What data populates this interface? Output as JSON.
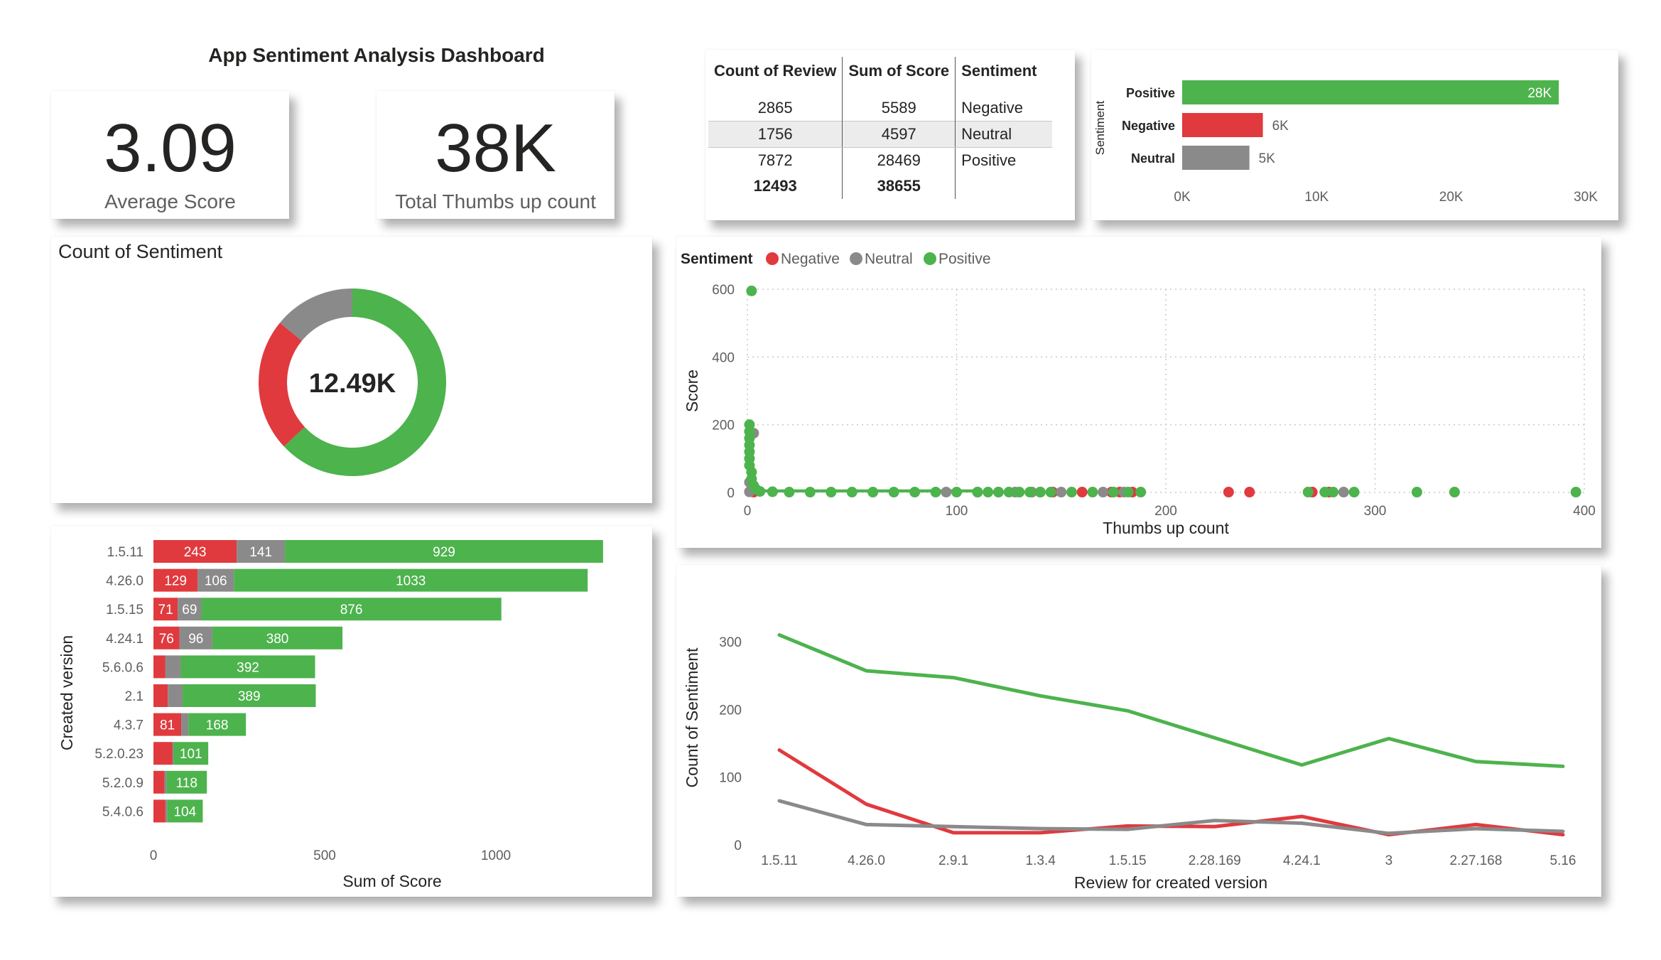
{
  "dashboard": {
    "title": "App Sentiment Analysis Dashboard",
    "colors": {
      "negative": "#e03a3e",
      "neutral": "#8a8a8a",
      "positive": "#4db34d"
    }
  },
  "kpis": [
    {
      "value": "3.09",
      "label": "Average Score"
    },
    {
      "value": "38K",
      "label": "Total Thumbs up count"
    }
  ],
  "review_table": {
    "headers": [
      "Count of Review",
      "Sum of Score",
      "Sentiment"
    ],
    "rows": [
      [
        "2865",
        "5589",
        "Negative"
      ],
      [
        "1756",
        "4597",
        "Neutral"
      ],
      [
        "7872",
        "28469",
        "Positive"
      ]
    ],
    "total": [
      "12493",
      "38655",
      ""
    ]
  },
  "chart_data": [
    {
      "type": "bar",
      "orientation": "horizontal",
      "ylabel": "Sentiment",
      "categories": [
        "Positive",
        "Negative",
        "Neutral"
      ],
      "values": [
        28000,
        6000,
        5000
      ],
      "data_labels": [
        "28K",
        "6K",
        "5K"
      ],
      "xlim": [
        0,
        30000
      ],
      "xticks": [
        "0K",
        "10K",
        "20K",
        "30K"
      ],
      "colors": [
        "#4db34d",
        "#e03a3e",
        "#8a8a8a"
      ]
    },
    {
      "type": "pie",
      "style": "donut",
      "title": "Count of Sentiment",
      "center_label": "12.49K",
      "labels": [
        "Positive",
        "Negative",
        "Neutral"
      ],
      "values": [
        7872,
        2865,
        1756
      ],
      "colors": [
        "#4db34d",
        "#e03a3e",
        "#8a8a8a"
      ]
    },
    {
      "type": "scatter",
      "legend_title": "Sentiment",
      "legend_position": "top-left",
      "xlabel": "Thumbs up count",
      "ylabel": "Score",
      "xlim": [
        0,
        400
      ],
      "ylim": [
        0,
        600
      ],
      "xticks": [
        0,
        100,
        200,
        300,
        400
      ],
      "yticks": [
        0,
        200,
        400,
        600
      ],
      "grid": true,
      "series": [
        {
          "name": "Negative",
          "color": "#e03a3e",
          "points": [
            [
              1,
              2
            ],
            [
              3,
              1
            ],
            [
              140,
              1
            ],
            [
              146,
              1
            ],
            [
              160,
              1
            ],
            [
              174,
              1
            ],
            [
              178,
              1
            ],
            [
              184,
              1
            ],
            [
              230,
              1
            ],
            [
              240,
              1
            ],
            [
              270,
              1
            ],
            [
              278,
              1
            ]
          ]
        },
        {
          "name": "Neutral",
          "color": "#8a8a8a",
          "points": [
            [
              1,
              30
            ],
            [
              3,
              175
            ],
            [
              1,
              2
            ],
            [
              95,
              1
            ],
            [
              110,
              1
            ],
            [
              120,
              1
            ],
            [
              128,
              1
            ],
            [
              136,
              1
            ],
            [
              150,
              1
            ],
            [
              170,
              1
            ],
            [
              180,
              1
            ],
            [
              285,
              1
            ]
          ]
        },
        {
          "name": "Positive",
          "color": "#4db34d",
          "points": [
            [
              2,
              595
            ],
            [
              1,
              200
            ],
            [
              1,
              180
            ],
            [
              1,
              160
            ],
            [
              1,
              140
            ],
            [
              1,
              120
            ],
            [
              1,
              100
            ],
            [
              1,
              80
            ],
            [
              2,
              60
            ],
            [
              2,
              40
            ],
            [
              3,
              20
            ],
            [
              4,
              10
            ],
            [
              6,
              3
            ],
            [
              12,
              2
            ],
            [
              20,
              1
            ],
            [
              30,
              1
            ],
            [
              40,
              1
            ],
            [
              50,
              1
            ],
            [
              60,
              1
            ],
            [
              70,
              1
            ],
            [
              80,
              1
            ],
            [
              90,
              1
            ],
            [
              100,
              1
            ],
            [
              110,
              1
            ],
            [
              115,
              1
            ],
            [
              120,
              1
            ],
            [
              125,
              1
            ],
            [
              130,
              1
            ],
            [
              135,
              1
            ],
            [
              140,
              1
            ],
            [
              145,
              1
            ],
            [
              155,
              1
            ],
            [
              165,
              1
            ],
            [
              175,
              1
            ],
            [
              182,
              1
            ],
            [
              188,
              1
            ],
            [
              268,
              1
            ],
            [
              276,
              1
            ],
            [
              280,
              1
            ],
            [
              290,
              1
            ],
            [
              320,
              1
            ],
            [
              338,
              1
            ],
            [
              396,
              1
            ]
          ]
        }
      ]
    },
    {
      "type": "bar",
      "orientation": "horizontal",
      "stacked": true,
      "xlabel": "Sum of Score",
      "ylabel": "Created version",
      "xlim": [
        0,
        1300
      ],
      "xticks": [
        0,
        500,
        1000
      ],
      "categories": [
        "1.5.11",
        "4.26.0",
        "1.5.15",
        "4.24.1",
        "5.6.0.6",
        "2.1",
        "4.3.7",
        "5.2.0.23",
        "5.2.0.9",
        "5.4.0.6"
      ],
      "series": [
        {
          "name": "Negative",
          "color": "#e03a3e",
          "values": [
            243,
            129,
            71,
            76,
            35,
            42,
            81,
            55,
            32,
            35
          ],
          "labels": [
            "243",
            "129",
            "71",
            "76",
            "",
            "",
            "81",
            "",
            "",
            ""
          ]
        },
        {
          "name": "Neutral",
          "color": "#8a8a8a",
          "values": [
            141,
            106,
            69,
            96,
            45,
            43,
            21,
            4,
            6,
            5
          ],
          "labels": [
            "141",
            "106",
            "69",
            "96",
            "",
            "",
            "",
            "",
            "",
            ""
          ]
        },
        {
          "name": "Positive",
          "color": "#4db34d",
          "values": [
            929,
            1033,
            876,
            380,
            392,
            389,
            168,
            101,
            118,
            104
          ],
          "labels": [
            "929",
            "1033",
            "876",
            "380",
            "392",
            "389",
            "168",
            "101",
            "118",
            "104"
          ]
        }
      ]
    },
    {
      "type": "line",
      "xlabel": "Review for created version",
      "ylabel": "Count of Sentiment",
      "ylim": [
        0,
        310
      ],
      "yticks": [
        0,
        100,
        200,
        300
      ],
      "categories": [
        "1.5.11",
        "4.26.0",
        "2.9.1",
        "1.3.4",
        "1.5.15",
        "2.28.169",
        "4.24.1",
        "3",
        "2.27.168",
        "5.16"
      ],
      "series": [
        {
          "name": "Positive",
          "color": "#4db34d",
          "values": [
            310,
            257,
            247,
            220,
            198,
            158,
            118,
            157,
            123,
            116
          ]
        },
        {
          "name": "Negative",
          "color": "#e03a3e",
          "values": [
            140,
            60,
            18,
            18,
            28,
            27,
            42,
            15,
            30,
            15
          ]
        },
        {
          "name": "Neutral",
          "color": "#8a8a8a",
          "values": [
            65,
            30,
            27,
            24,
            23,
            36,
            32,
            17,
            24,
            20
          ]
        }
      ]
    }
  ]
}
